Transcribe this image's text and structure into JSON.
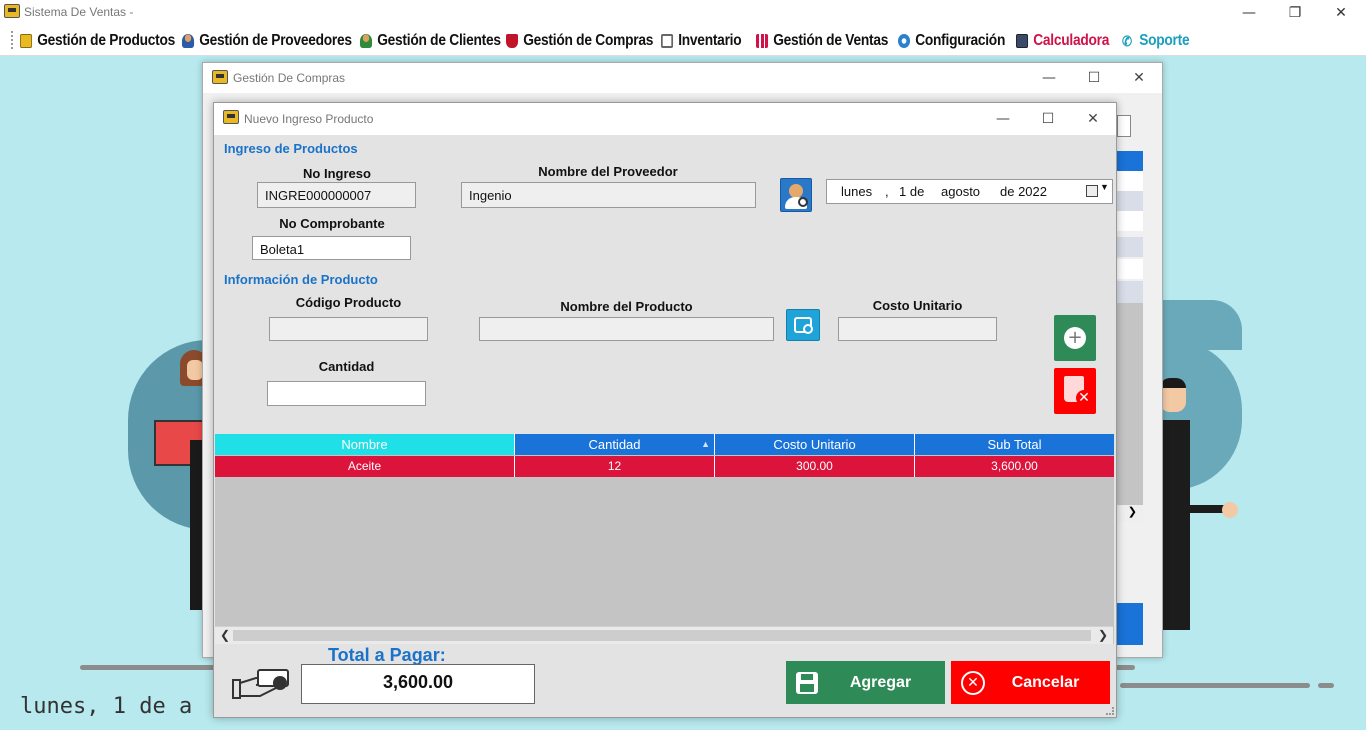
{
  "app": {
    "title": "Sistema De Ventas -"
  },
  "menu": {
    "items": [
      {
        "label": "Gestión de Productos",
        "icon": "folder-icon",
        "color": "#111111"
      },
      {
        "label": "Gestión de Proveedores",
        "icon": "user-icon",
        "color": "#111111"
      },
      {
        "label": "Gestión de Clientes",
        "icon": "user-icon",
        "color": "#111111"
      },
      {
        "label": "Gestión de Compras",
        "icon": "cart-icon",
        "color": "#111111"
      },
      {
        "label": "Inventario",
        "icon": "clipboard-icon",
        "color": "#111111"
      },
      {
        "label": "Gestión de Ventas",
        "icon": "chart-icon",
        "color": "#111111"
      },
      {
        "label": "Configuración",
        "icon": "gear-icon",
        "color": "#111111"
      },
      {
        "label": "Calculadora",
        "icon": "calculator-icon",
        "color": "#d1124a"
      },
      {
        "label": "Soporte",
        "icon": "phone-icon",
        "color": "#1a9fbf"
      }
    ]
  },
  "background": {
    "date_text": "lunes, 1 de a"
  },
  "compras_window": {
    "title": "Gestión De Compras"
  },
  "dialog": {
    "title": "Nuevo Ingreso Producto",
    "section_ingreso": "Ingreso de Productos",
    "no_ingreso_label": "No Ingreso",
    "no_ingreso_value": "INGRE000000007",
    "no_comprobante_label": "No Comprobante",
    "no_comprobante_value": "Boleta1",
    "proveedor_label": "Nombre del Proveedor",
    "proveedor_value": "Ingenio",
    "date": {
      "day_name": "lunes",
      "sep": ",",
      "day": "1 de",
      "month": "agosto",
      "year": "de 2022"
    },
    "section_producto": "Información de Producto",
    "codigo_label": "Código Producto",
    "codigo_value": "",
    "nombre_producto_label": "Nombre del Producto",
    "nombre_producto_value": "",
    "costo_label": "Costo Unitario",
    "costo_value": "",
    "cantidad_label": "Cantidad",
    "cantidad_value": ""
  },
  "grid": {
    "columns": [
      "Nombre",
      "Cantidad",
      "Costo Unitario",
      "Sub Total"
    ],
    "rows": [
      [
        "Aceite",
        "12",
        "300.00",
        "3,600.00"
      ]
    ]
  },
  "footer": {
    "total_label": "Total a Pagar:",
    "total_value": "3,600.00",
    "agregar_label": "Agregar",
    "cancelar_label": "Cancelar"
  },
  "colors": {
    "accent_blue": "#1a73d9",
    "selected_header": "#1fe0e6",
    "row_red": "#dc143c",
    "agregar_green": "#2e8b57",
    "cancelar_red": "#ff0000",
    "background": "#b7e9ee"
  }
}
